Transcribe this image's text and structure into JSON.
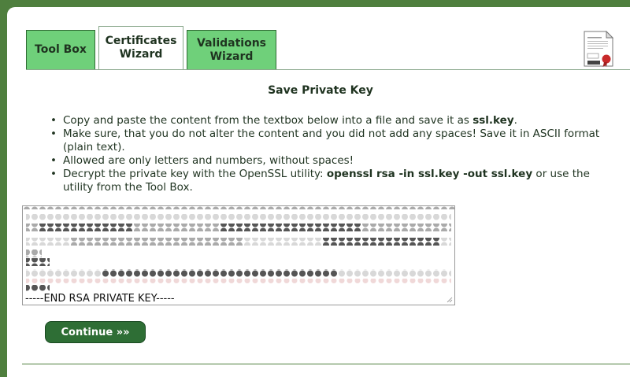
{
  "tabs": [
    {
      "label_line1": "Tool Box",
      "label_line2": "",
      "active": false
    },
    {
      "label_line1": "Certificates",
      "label_line2": "Wizard",
      "active": true
    },
    {
      "label_line1": "Validations",
      "label_line2": "Wizard",
      "active": false
    }
  ],
  "page": {
    "title": "Save Private Key"
  },
  "instructions": {
    "item1_text": "Copy and paste the content from the textbox below into a file and save it as ",
    "item1_bold": "ssl.key",
    "item1_end": ".",
    "item2_text": "Make sure, that you do not alter the content and you did not add any spaces! Save it in ASCII format (plain text).",
    "item3_text": "Allowed are only letters and numbers, without spaces!",
    "item4_text": "Decrypt the private key with the OpenSSL utility: ",
    "item4_bold": "openssl rsa -in ssl.key -out ssl.key",
    "item4_end": " or use the utility from the Tool Box."
  },
  "keybox": {
    "visible_end_line": "-----END RSA PRIVATE KEY-----"
  },
  "buttons": {
    "continue_label": "Continue »»"
  },
  "icons": {
    "certificate": "certificate-icon",
    "resize": "resize-grip-icon"
  },
  "colors": {
    "frame_green": "#4f7f3e",
    "tab_green": "#6fd07a",
    "button_green": "#2e6e35",
    "text_dark": "#1f3320"
  }
}
